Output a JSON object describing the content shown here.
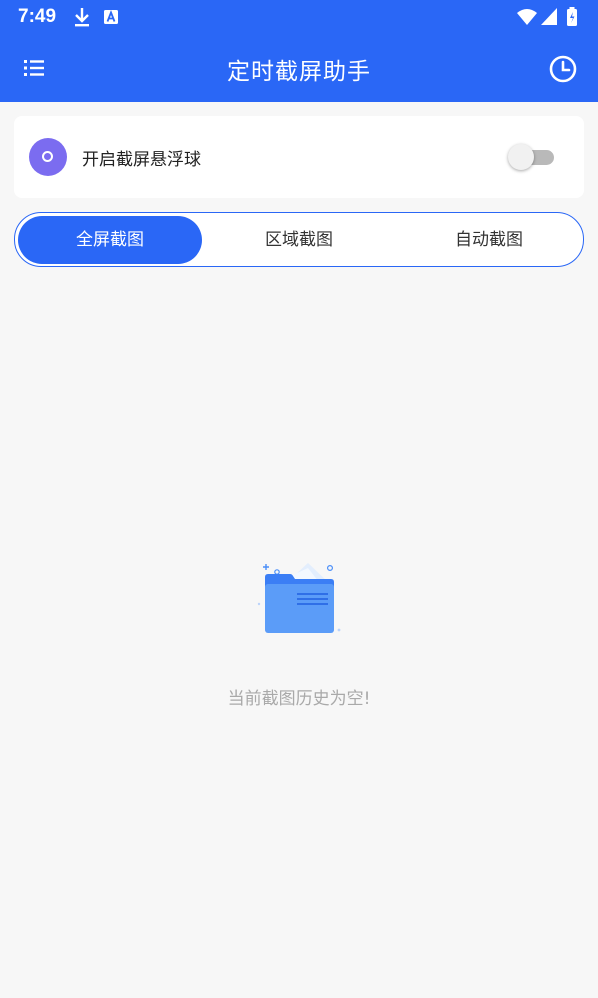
{
  "status_bar": {
    "time": "7:49",
    "icons": [
      "download-icon",
      "notification-a-icon",
      "wifi-icon",
      "signal-icon",
      "battery-icon"
    ]
  },
  "app_bar": {
    "title": "定时截屏助手",
    "menu_icon": "menu-list-icon",
    "history_icon": "clock-icon"
  },
  "floating_ball_card": {
    "label": "开启截屏悬浮球",
    "enabled": false,
    "icon_color": "#7b6cf0"
  },
  "tabs": [
    {
      "label": "全屏截图",
      "active": true
    },
    {
      "label": "区域截图",
      "active": false
    },
    {
      "label": "自动截图",
      "active": false
    }
  ],
  "empty_state": {
    "message": "当前截图历史为空!"
  },
  "colors": {
    "primary": "#2a67f6",
    "background": "#f7f7f7"
  }
}
